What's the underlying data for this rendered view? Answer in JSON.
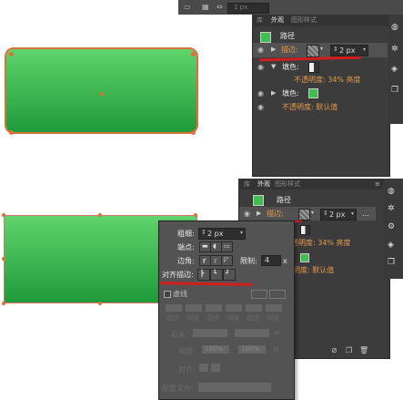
{
  "top": {
    "tabs": [
      "库",
      "外观",
      "图形样式"
    ],
    "stroke_value": "2 px",
    "small_value": "1 px",
    "path_label": "路径",
    "stroke_label": "描边:",
    "fill_label_1": "填色:",
    "opacity_1": "不透明度: 34% 亮度",
    "fill_label_2": "填色:",
    "opacity_2": "不透明度: 默认值"
  },
  "bottom": {
    "tabs": [
      "库",
      "外观",
      "图形样式"
    ],
    "path_label": "路径",
    "stroke_label": "描边:",
    "stroke_value": "2 px",
    "more_label": "...",
    "opacity_1": "透明度: 34% 亮度",
    "opacity_2": "明度: 默认值",
    "popup": {
      "weight_label": "粗细:",
      "weight_value": "2 px",
      "cap_label": "端点:",
      "corner_label": "边角:",
      "limit_label": "限制:",
      "limit_value": "4",
      "limit_unit": "x",
      "align_label": "对齐描边:",
      "dashed_label": "虚线",
      "dash_cols": [
        "虚线",
        "间隙",
        "虚线",
        "间隙",
        "虚线",
        "间隙"
      ],
      "arrow_label": "箭头:",
      "scale_label": "缩放:",
      "scale_1": "100%",
      "scale_2": "100%",
      "align_label_2": "对齐:",
      "profile_label": "配置文件:"
    }
  },
  "colors": {
    "panel_dark": "#3c3c3c",
    "panel_mid": "#4a4a4a",
    "shape_green_top": "#5fd46c",
    "shape_green_bottom": "#1f9a3a",
    "shape_stroke": "#e0703a",
    "highlight_red": "#d21e1e",
    "orange_text": "#e59a4a"
  }
}
